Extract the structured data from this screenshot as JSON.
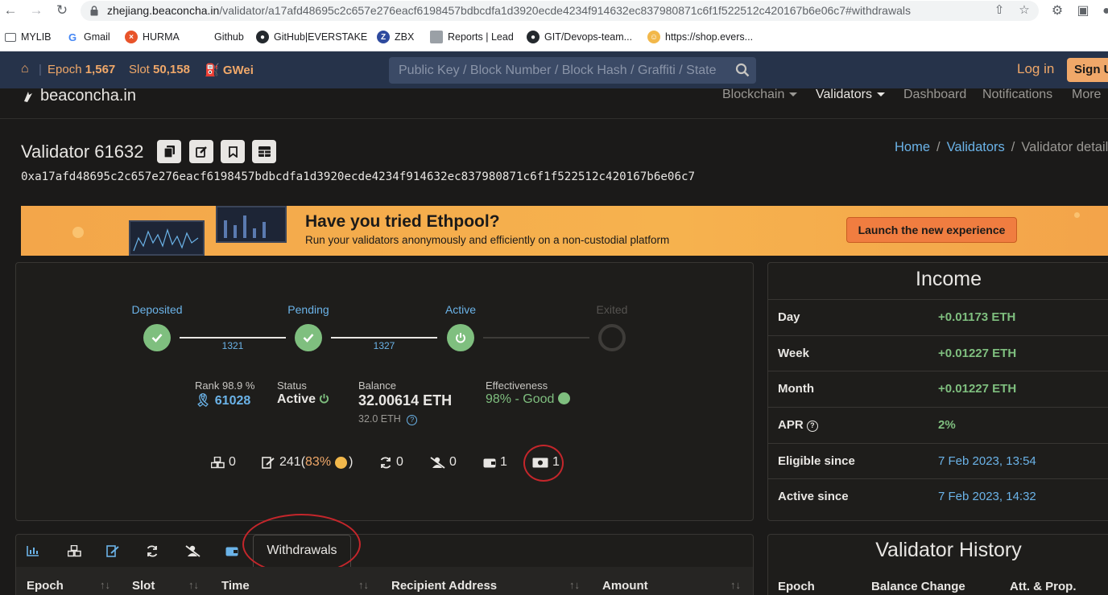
{
  "browser": {
    "url_host": "zhejiang.beaconcha.in",
    "url_path": "/validator/a17afd48695c2c657e276eacf6198457bdbcdfa1d3920ecde4234f914632ec837980871c6f1f522512c420167b6e06c7#withdrawals",
    "bookmarks": [
      "MYLIB",
      "Gmail",
      "HURMA",
      "Github",
      "GitHub|EVERSTAKE",
      "ZBX",
      "Reports | Lead",
      "GIT/Devops-team...",
      "https://shop.evers..."
    ]
  },
  "topbar": {
    "epoch_label": "Epoch",
    "epoch_value": "1,567",
    "slot_label": "Slot",
    "slot_value": "50,158",
    "gwei_label": "GWei",
    "search_placeholder": "Public Key / Block Number / Block Hash / Graffiti / State",
    "login": "Log in",
    "signup": "Sign Up"
  },
  "nav": {
    "logo": "beaconcha.in",
    "items": [
      "Blockchain",
      "Validators",
      "Dashboard",
      "Notifications",
      "More"
    ]
  },
  "header": {
    "title": "Validator 61632",
    "pubkey": "0xa17afd48695c2c657e276eacf6198457bdbcdfa1d3920ecde4234f914632ec837980871c6f1f522512c420167b6e06c7",
    "breadcrumb": [
      "Home",
      "Validators",
      "Validator details"
    ]
  },
  "banner": {
    "heading": "Have you tried Ethpool?",
    "text": "Run your validators anonymously and efficiently on a non-custodial platform",
    "button": "Launch the new experience"
  },
  "lifecycle": {
    "stages": [
      "Deposited",
      "Pending",
      "Active",
      "Exited"
    ],
    "gaps": [
      "1321",
      "1327"
    ]
  },
  "stats": {
    "rank_label": "Rank 98.9 %",
    "rank_value": "61028",
    "status_label": "Status",
    "status_value": "Active",
    "balance_label": "Balance",
    "balance_value": "32.00614 ETH",
    "balance_sub": "32.0 ETH",
    "eff_label": "Effectiveness",
    "eff_value": "98% - Good"
  },
  "counters": {
    "proposals": "0",
    "attestations": "241",
    "attestations_pct": "83%",
    "sync": "0",
    "slashings": "0",
    "deposits": "1",
    "withdrawals": "1",
    "open_paren": "(",
    "close_paren": ")"
  },
  "income": {
    "title": "Income",
    "rows": [
      {
        "label": "Day",
        "value": "+0.01173 ETH"
      },
      {
        "label": "Week",
        "value": "+0.01227 ETH"
      },
      {
        "label": "Month",
        "value": "+0.01227 ETH"
      },
      {
        "label": "APR",
        "value": "2%"
      },
      {
        "label": "Eligible since",
        "value": "7 Feb 2023, 13:54"
      },
      {
        "label": "Active since",
        "value": "7 Feb 2023, 14:32"
      }
    ]
  },
  "history": {
    "title": "Validator History",
    "columns": [
      "Epoch",
      "Balance Change",
      "Att. & Prop."
    ]
  },
  "tabs": {
    "active_label": "Withdrawals",
    "columns": [
      "Epoch",
      "Slot",
      "Time",
      "Recipient Address",
      "Amount"
    ]
  },
  "colors": {
    "accent_orange": "#f0a869",
    "link_blue": "#6bb3e8",
    "success_green": "#7fbf7f",
    "annotation_red": "#c4262b"
  }
}
